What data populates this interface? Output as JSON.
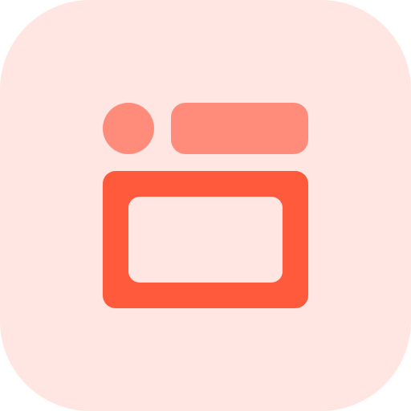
{
  "icon": {
    "name": "oven-icon",
    "colors": {
      "tile_background": "#FFE6E2",
      "accent_light": "#FF8C7A",
      "accent_dark": "#FF5A3C",
      "window_fill": "#FFE6E2"
    }
  }
}
